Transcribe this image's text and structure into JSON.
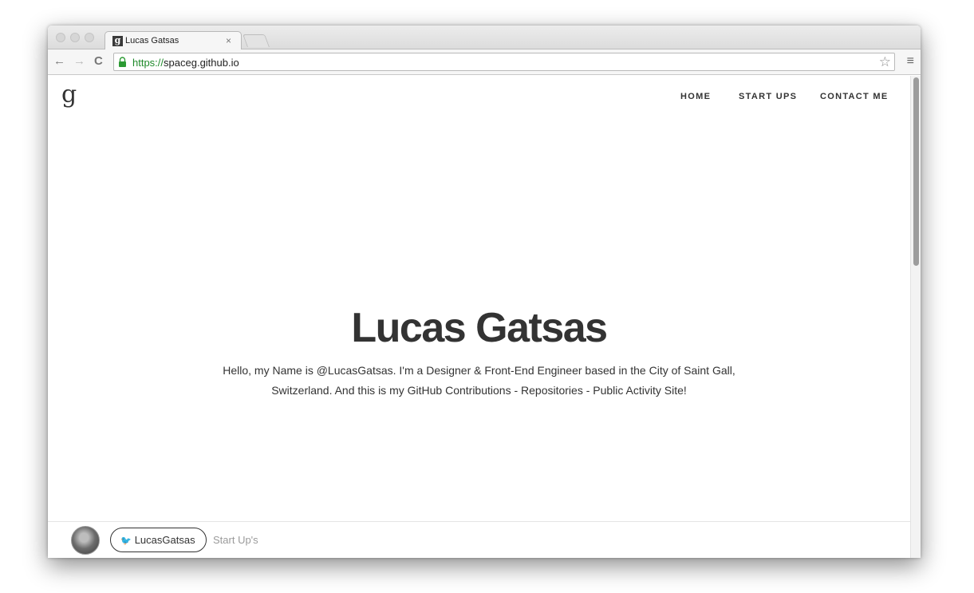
{
  "browser": {
    "tab": {
      "favicon": "g",
      "title": "Lucas Gatsas",
      "close_glyph": "×"
    },
    "back_glyph": "←",
    "forward_glyph": "→",
    "reload_glyph": "C",
    "url_scheme": "https://",
    "url_rest": "spaceg.github.io",
    "star_glyph": "☆",
    "menu_glyph": "≡"
  },
  "site": {
    "logo": "g",
    "nav": [
      "HOME",
      "START UPS",
      "CONTACT ME"
    ],
    "hero": {
      "title": "Lucas Gatsas",
      "line1": "Hello, my Name is @LucasGatsas. I'm a Designer & Front-End Engineer based in the City of Saint Gall,",
      "line2": "Switzerland. And this is my GitHub Contributions - Repositories - Public Activity Site!"
    },
    "footer": {
      "twitter_glyph": "🐦",
      "twitter_label": "LucasGatsas",
      "startups_link": "Start Up's"
    }
  },
  "colors": {
    "text": "#333333",
    "secure_green": "#1f8a2a",
    "muted": "#9a9a9a"
  }
}
